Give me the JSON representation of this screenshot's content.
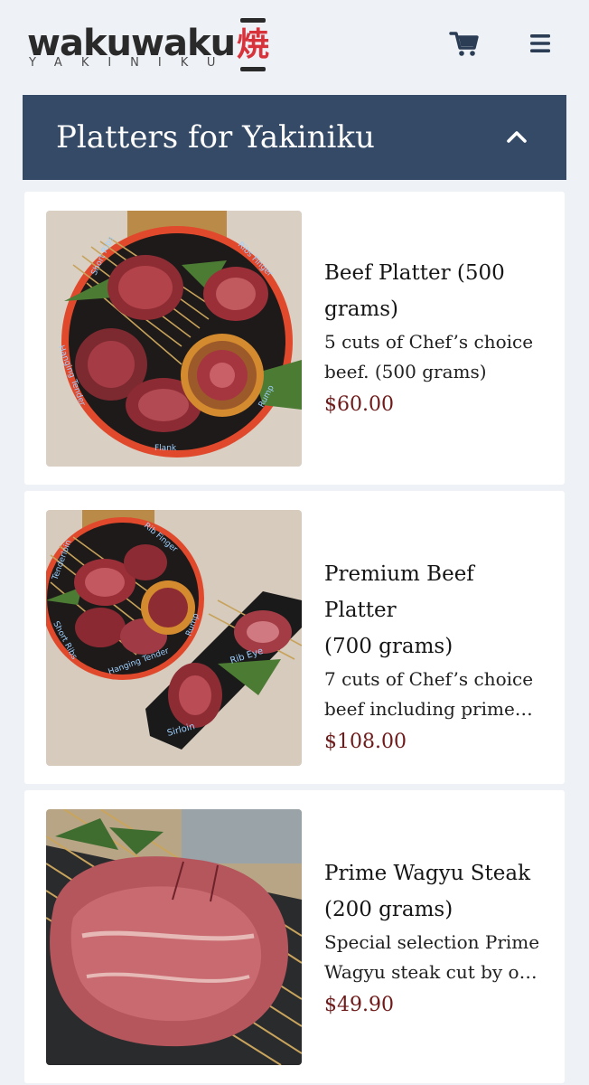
{
  "header": {
    "brand_name": "wakuwaku",
    "brand_kanji": "焼",
    "brand_tagline": "YAKINIKU",
    "cart_icon": "cart-icon",
    "menu_icon": "hamburger-menu-icon"
  },
  "section": {
    "title": "Platters for Yakiniku",
    "toggle_icon": "chevron-up-icon"
  },
  "items": [
    {
      "name_line1": "Beef Platter (500",
      "name_line2": "grams)",
      "desc_line1": "5 cuts of Chef’s choice",
      "desc_line2": "beef. (500 grams)",
      "price": "$60.00",
      "image_labels": [
        "Short Ribs",
        "Ribs Finger",
        "Hanging Tender",
        "Rump",
        "Flank"
      ]
    },
    {
      "name_line1": "Premium Beef Platter",
      "name_line2": "(700 grams)",
      "desc_line1": "7 cuts of Chef’s choice",
      "desc_line2": "beef including prime…",
      "price": "$108.00",
      "image_labels": [
        "Rib Finger",
        "Tenderloin",
        "Short Ribs",
        "Rump",
        "Hanging Tender",
        "Rib Eye",
        "Sirloin"
      ]
    },
    {
      "name_line1": "Prime Wagyu Steak",
      "name_line2": "(200 grams)",
      "desc_line1": "Special selection Prime",
      "desc_line2": "Wagyu steak cut by o…",
      "price": "$49.90"
    }
  ],
  "colors": {
    "background": "#eef1f6",
    "section_bar": "#344a66",
    "price": "#6e1a1a",
    "brand_accent": "#d8333b"
  }
}
